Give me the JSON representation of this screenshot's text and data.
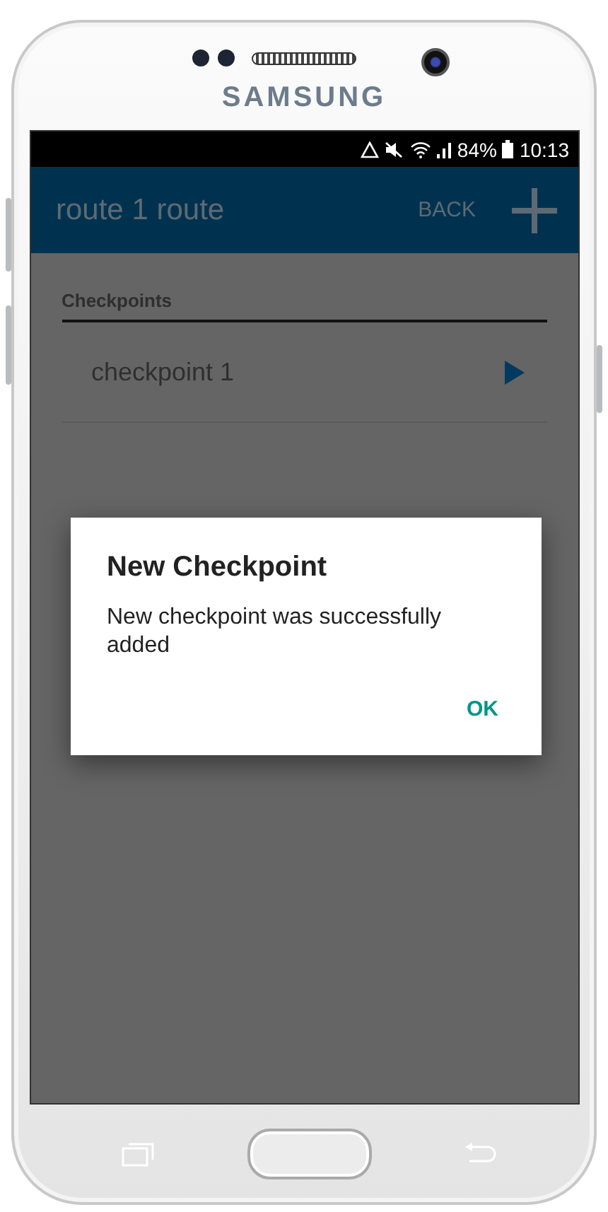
{
  "device": {
    "brand": "SAMSUNG"
  },
  "status_bar": {
    "battery": "84%",
    "time": "10:13"
  },
  "app_bar": {
    "title": "route 1 route",
    "back_label": "BACK"
  },
  "checkpoints": {
    "heading": "Checkpoints",
    "items": [
      {
        "label": "checkpoint 1"
      }
    ]
  },
  "dialog": {
    "title": "New Checkpoint",
    "message": "New checkpoint was successfully added",
    "buttons": [
      "OK"
    ]
  }
}
